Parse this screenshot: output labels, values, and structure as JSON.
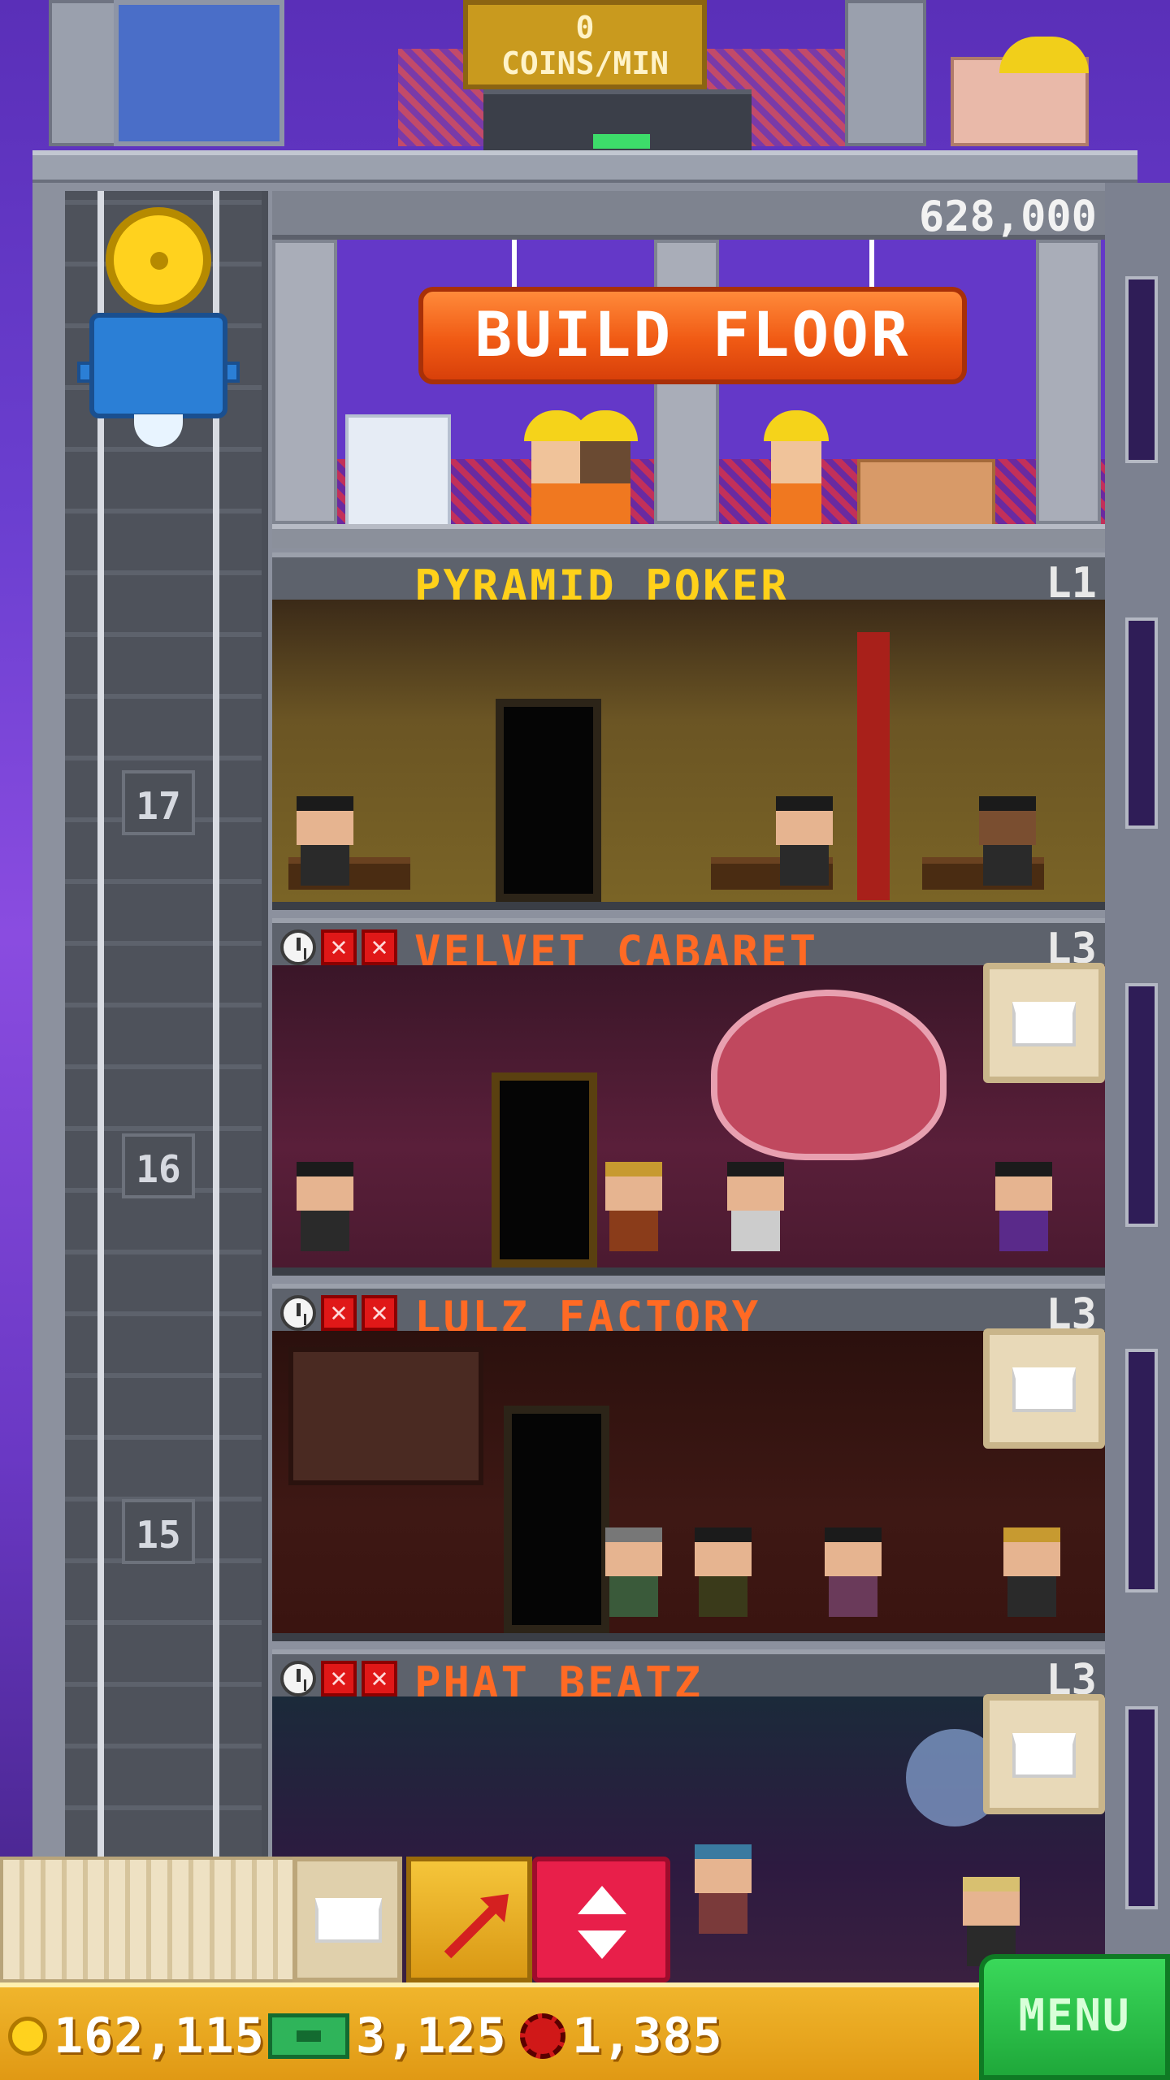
{
  "roof": {
    "coins_rate_value": "0",
    "coins_rate_label": "COINS/MIN"
  },
  "build": {
    "cost": "628,000",
    "button_label": "BUILD FLOOR"
  },
  "elevator": {
    "floor_numbers": [
      "17",
      "16",
      "15"
    ]
  },
  "floors": [
    {
      "name": "PYRAMID POKER",
      "level": "L1",
      "title_color": "#ffd11a"
    },
    {
      "name": "VELVET CABARET",
      "level": "L3",
      "title_color": "#ff6a24"
    },
    {
      "name": "LULZ FACTORY",
      "level": "L3",
      "title_color": "#ff6a24"
    },
    {
      "name": "PHAT BEATZ",
      "level": "L3",
      "title_color": "#ff6a24"
    }
  ],
  "currencies": {
    "coins": "162,115",
    "bux": "3,125",
    "chips": "1,385"
  },
  "menu": {
    "label": "MENU"
  },
  "colors": {
    "accent_orange": "#f05a14",
    "menu_green": "#1fa83a",
    "elevator_red": "#e81f4a",
    "gold": "#ffd11a"
  },
  "icons": [
    "clock-icon",
    "warning-x-icon",
    "stock-crate-icon",
    "raffle-arrow-icon",
    "elevator-updown-icon",
    "coin-icon",
    "bux-icon",
    "chip-icon"
  ]
}
